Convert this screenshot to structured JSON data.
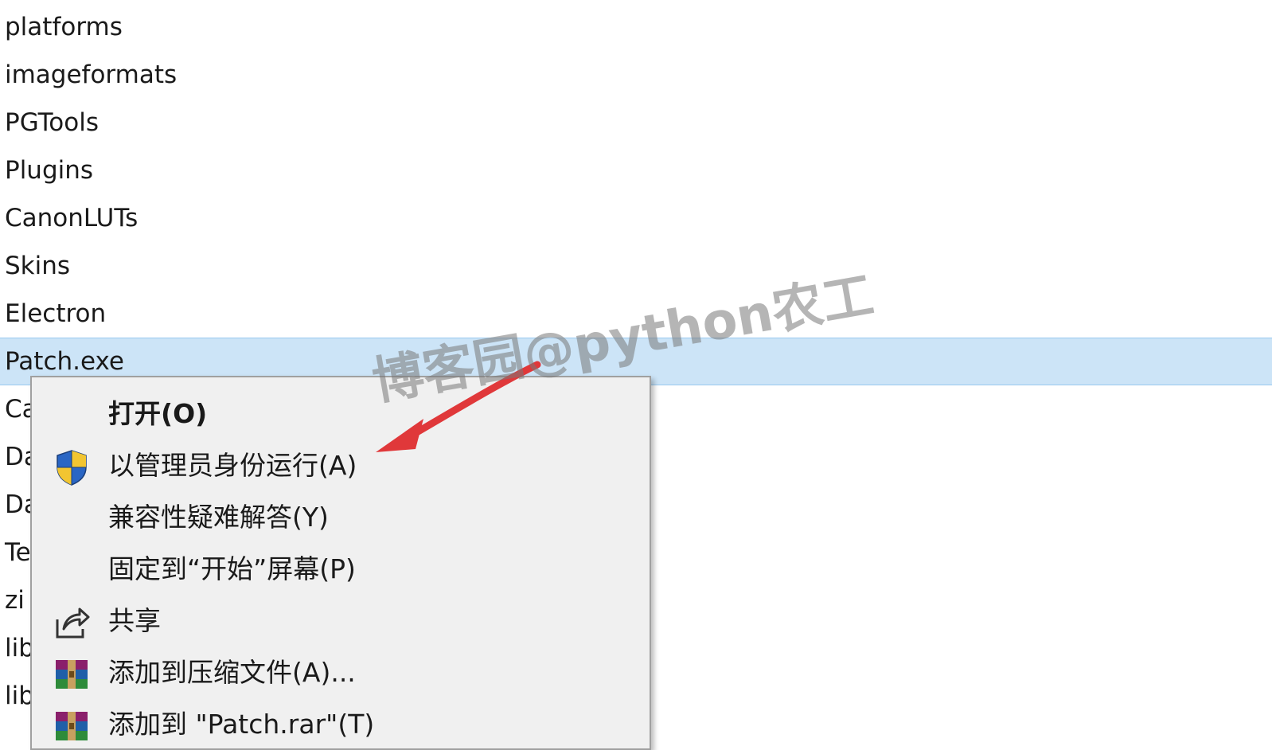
{
  "files": [
    "platforms",
    "imageformats",
    "PGTools",
    "Plugins",
    "CanonLUTs",
    "Skins",
    "Electron",
    "Patch.exe",
    "Ca",
    "Da",
    "Da",
    "Te",
    "zi",
    "lib",
    "lib"
  ],
  "selected_file": "Patch.exe",
  "context_menu": {
    "items": [
      {
        "label": "打开(O)",
        "icon": "none",
        "bold": true
      },
      {
        "label": "以管理员身份运行(A)",
        "icon": "uac-shield-icon"
      },
      {
        "label": "兼容性疑难解答(Y)",
        "icon": "none"
      },
      {
        "label": "固定到“开始”屏幕(P)",
        "icon": "none"
      },
      {
        "label": "共享",
        "icon": "share-icon"
      },
      {
        "label": "添加到压缩文件(A)...",
        "icon": "winrar-icon"
      },
      {
        "label": "添加到 \"Patch.rar\"(T)",
        "icon": "winrar-icon"
      }
    ]
  },
  "watermark": "博客园@python农工",
  "colors": {
    "selection": "#cce4f7",
    "selection_border": "#99c9ef",
    "menu_background": "#f0f0f0",
    "arrow": "#e0383a"
  }
}
